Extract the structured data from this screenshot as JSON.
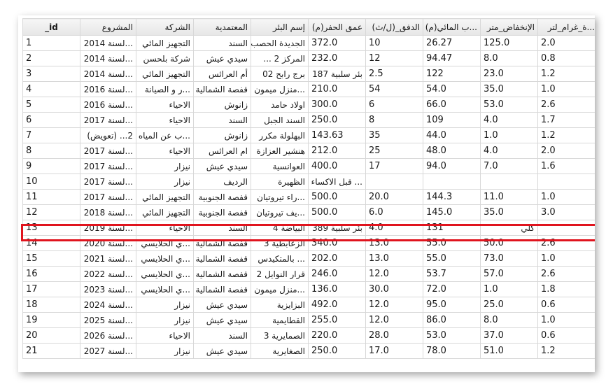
{
  "columns": [
    "_id",
    "المشروع",
    "الشركة",
    "المعتمدية",
    "إسم البئر",
    "عمق الحفر(م)",
    "الدفق_(ل/ث)",
    "...ب المائي(م)",
    "الإنخفاض_متر",
    "...ة_غرام_لتر"
  ],
  "rows": [
    [
      "1",
      "...لسنة 2014",
      "التجهيز المائي",
      "السند",
      "الجديدة الحصب",
      "372.0",
      "10",
      "26.27",
      "125.0",
      "2.0"
    ],
    [
      "2",
      "...لسنة 2014",
      "شركة بلحسن",
      "سيدي عيش",
      "المركز 2 ...",
      "232.0",
      "12",
      "94.47",
      "8.0",
      "0.8"
    ],
    [
      "3",
      "...لسنة 2014",
      "التجهيز المائي",
      "أم العرائس",
      "برج رابح 02",
      "بئر سلبية 187",
      "2.5",
      "122",
      "23.0",
      "1.2"
    ],
    [
      "4",
      "...لسنة 2016",
      "...ر و الصيانة",
      "قفصة الشمالية",
      "...منزل ميمون",
      "210.0",
      "54",
      "54.0",
      "35.0",
      "1.0"
    ],
    [
      "5",
      "...لسنة 2016",
      "الاحياء",
      "زانوش",
      "اولاد حامد",
      "300.0",
      "6",
      "66.0",
      "53.0",
      "2.6"
    ],
    [
      "6",
      "...لسنة 2017",
      "الاحياء",
      "السند",
      "السند الجبل",
      "250.0",
      "8",
      "109",
      "4.0",
      "1.7"
    ],
    [
      "7",
      "2... (تعويض)",
      "...ب عن المياه",
      "زانوش",
      "البهلولة مكرر",
      "143.63",
      "35",
      "44.0",
      "1.0",
      "1.2"
    ],
    [
      "8",
      "...لسنة 2017",
      "الاحياء",
      "ام العرائس",
      "هنشير العزازة",
      "212.0",
      "25",
      "48.0",
      "4.0",
      "2.0"
    ],
    [
      "9",
      "...لسنة 2017",
      "نيزار",
      "سيدي عيش",
      "العوانسية",
      "400.0",
      "17",
      "94.0",
      "7.0",
      "1.6"
    ],
    [
      "10",
      "...لسنة 2017",
      "نيزار",
      "الرديف",
      "الظهيرة",
      "... قبل الاكساء",
      "",
      "",
      "",
      ""
    ],
    [
      "11",
      "...لسنة 2017",
      "التجهيز المائي",
      "قفصة الجنوبية",
      "...راء تيروتيان",
      "500.0",
      "20.0",
      "144.3",
      "11.0",
      "1.0"
    ],
    [
      "12",
      "...لسنة 2018",
      "التجهيز المائي",
      "قفصة الجنوبية",
      "...يف تيروتيان",
      "500.0",
      "6.0",
      "145.0",
      "35.0",
      "3.0"
    ],
    [
      "13",
      "...لسنة 2019",
      "الاحياء",
      "السند",
      "البياضة 4",
      "بئر سلبية 389",
      "4.0",
      "131",
      "كلي",
      ""
    ],
    [
      "14",
      "...لسنة 2020",
      "...ي الحلايسي",
      "قفصة الشمالية",
      "الزعابطية 3",
      "340.0",
      "13.0",
      "55.0",
      "50.0",
      "2.6"
    ],
    [
      "15",
      "...لسنة 2021",
      "...ي الحلايسي",
      "قفصة الشمالية",
      "... بالمتكيدس",
      "202.0",
      "13.0",
      "55.0",
      "73.0",
      "1.0"
    ],
    [
      "16",
      "...لسنة 2022",
      "...ي الحلايسي",
      "قفصة الشمالية",
      "قرار النوايل 2",
      "246.0",
      "12.0",
      "53.7",
      "57.0",
      "2.6"
    ],
    [
      "17",
      "...لسنة 2023",
      "...ي الحلايسي",
      "قفصة الشمالية",
      "...منزل ميمون",
      "136.0",
      "30.0",
      "72.0",
      "1.0",
      "1.8"
    ],
    [
      "18",
      "...لسنة 2024",
      "نيزار",
      "سيدي عيش",
      "البزايزية",
      "492.0",
      "12.0",
      "95.0",
      "25.0",
      "0.6"
    ],
    [
      "19",
      "...لسنة 2025",
      "نيزار",
      "سيدي عيش",
      "القطايمية",
      "255.0",
      "12.0",
      "86.0",
      "8.0",
      "1.0"
    ],
    [
      "20",
      "...لسنة 2026",
      "الاحياء",
      "السند",
      "الصمايرية 3",
      "220.0",
      "28.0",
      "53.0",
      "37.0",
      "0.6"
    ],
    [
      "21",
      "...لسنة 2027",
      "نيزار",
      "سيدي عيش",
      "الصغايرية",
      "250.0",
      "17.0",
      "78.0",
      "51.0",
      "1.2"
    ]
  ],
  "highlighted_row_id": "13",
  "colors": {
    "highlight_border": "#e0141e",
    "grid": "#d8d8d8",
    "header_bg": "#eeeeee"
  }
}
